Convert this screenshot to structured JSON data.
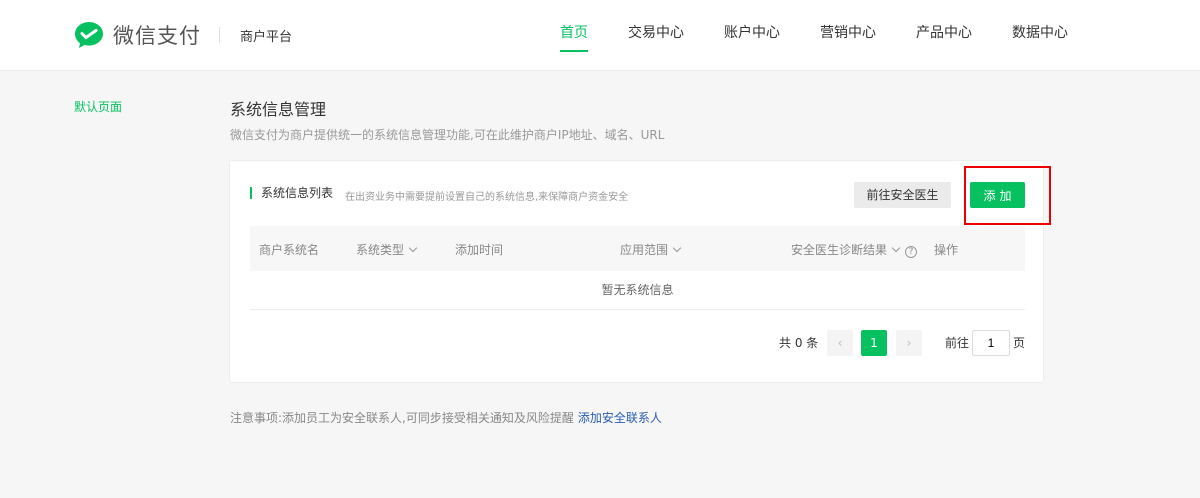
{
  "header": {
    "brand": "微信支付",
    "platform": "商户平台",
    "nav": [
      "首页",
      "交易中心",
      "账户中心",
      "营销中心",
      "产品中心",
      "数据中心"
    ],
    "active": 0
  },
  "sidebar": {
    "item": "默认页面"
  },
  "page": {
    "title": "系统信息管理",
    "desc": "微信支付为商户提供统一的系统信息管理功能,可在此维护商户IP地址、域名、URL"
  },
  "card": {
    "title": "系统信息列表",
    "hint": "在出资业务中需要提前设置自己的系统信息,来保障商户资金安全",
    "doctor_btn": "前往安全医生",
    "add_btn": "添加",
    "columns": [
      "商户系统名",
      "系统类型",
      "添加时间",
      "应用范围",
      "安全医生诊断结果",
      "操作"
    ],
    "empty": "暂无系统信息",
    "pager": {
      "total": "共 0 条",
      "prev": "‹",
      "current": "1",
      "next": "›",
      "goto": "前往",
      "page_value": "1",
      "page_suffix": "页"
    }
  },
  "note": {
    "text": "注意事项:添加员工为安全联系人,可同步接受相关通知及风险提醒",
    "link": "添加安全联系人"
  },
  "colors": {
    "accent": "#07c160",
    "link": "#2a5db0"
  }
}
